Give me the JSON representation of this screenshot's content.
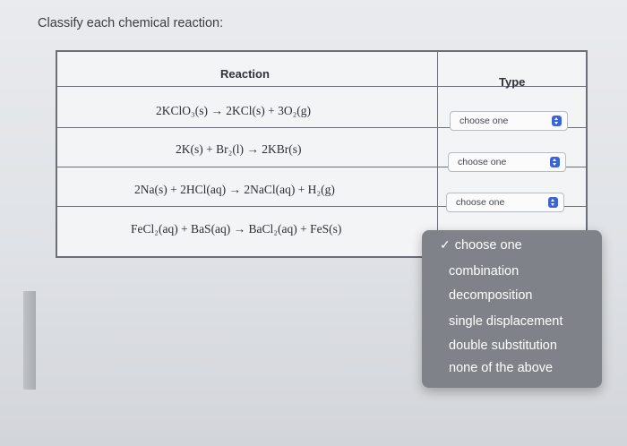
{
  "question": {
    "title": "Classify each chemical reaction:"
  },
  "table": {
    "headers": {
      "reaction": "Reaction",
      "type": "Type"
    },
    "rows": [
      {
        "reaction": "2KClO₃(s) → 2KCl(s) + 3O₂(g)",
        "select_value": "choose one"
      },
      {
        "reaction": "2K(s) + Br₂(l) → 2KBr(s)",
        "select_value": "choose one"
      },
      {
        "reaction": "2Na(s) + 2HCl(aq) → 2NaCl(aq) + H₂(g)",
        "select_value": "choose one"
      },
      {
        "reaction": "FeCl₂(aq) + BaS(aq) → BaCl₂(aq) + FeS(s)",
        "select_value": "choose one"
      }
    ]
  },
  "dropdown": {
    "check_glyph": "✓",
    "options": [
      {
        "label": "choose one",
        "selected": true
      },
      {
        "label": "combination",
        "selected": false
      },
      {
        "label": "decomposition",
        "selected": false
      },
      {
        "label": "single displacement",
        "selected": false
      },
      {
        "label": "double substitution",
        "selected": false
      },
      {
        "label": "none of the above",
        "selected": false
      }
    ]
  },
  "colors": {
    "accent": "#3b64d8",
    "menu_bg": "#7f8389"
  }
}
